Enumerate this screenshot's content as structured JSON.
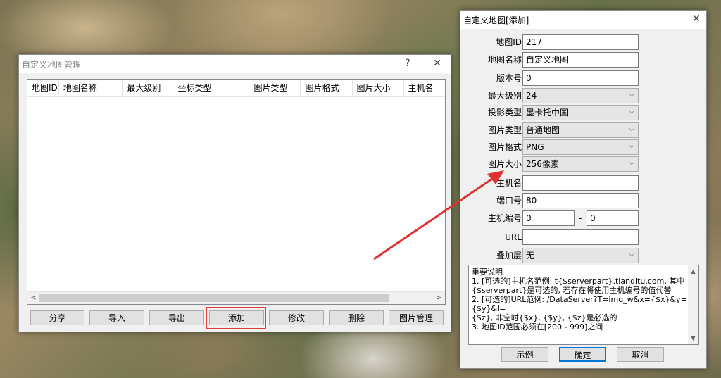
{
  "manager": {
    "title": "自定义地图管理",
    "help": "?",
    "close": "✕",
    "columns": [
      "地图ID",
      "地图名称",
      "最大级别",
      "坐标类型",
      "图片类型",
      "图片格式",
      "图片大小",
      "主机名"
    ],
    "scroll_left": "<",
    "scroll_right": ">",
    "buttons": {
      "share": "分享",
      "import": "导入",
      "export": "导出",
      "add": "添加",
      "modify": "修改",
      "delete": "删除",
      "image_manage": "图片管理"
    }
  },
  "add_dialog": {
    "title": "自定义地图[添加]",
    "close": "✕",
    "fields": {
      "map_id": {
        "label": "地图ID",
        "value": "217"
      },
      "map_name": {
        "label": "地图名称",
        "value": "自定义地图"
      },
      "version": {
        "label": "版本号",
        "value": "0"
      },
      "max_level": {
        "label": "最大级别",
        "value": "24"
      },
      "projection": {
        "label": "投影类型",
        "value": "墨卡托中国"
      },
      "image_type": {
        "label": "图片类型",
        "value": "普通地图"
      },
      "image_format": {
        "label": "图片格式",
        "value": "PNG"
      },
      "image_size": {
        "label": "图片大小",
        "value": "256像素"
      },
      "host": {
        "label": "主机名",
        "value": ""
      },
      "port": {
        "label": "端口号",
        "value": "80"
      },
      "host_num": {
        "label": "主机编号",
        "from": "0",
        "sep": "-",
        "to": "0"
      },
      "url": {
        "label": "URL",
        "value": ""
      },
      "overlay": {
        "label": "叠加层",
        "value": "无"
      }
    },
    "notes": {
      "title": "重要说明",
      "line1": "1. [可选的]主机名范例: t{$serverpart}.tianditu.com, 其中",
      "line2": "{$serverpart}是可选的, 若存在将使用主机编号的值代替",
      "line3": "2. [可选的]URL范例: /DataServer?T=img_w&x={$x}&y={$y}&l=",
      "line4": "{$z}, 非空时{$x}, {$y}, {$z}是必选的",
      "line5": "3. 地图ID范围必须在[200 - 999]之间"
    },
    "buttons": {
      "example": "示例",
      "ok": "确定",
      "cancel": "取消"
    }
  },
  "colors": {
    "arrow": "#e03030",
    "highlight": "#e04040",
    "default_button_border": "#0078d7"
  }
}
